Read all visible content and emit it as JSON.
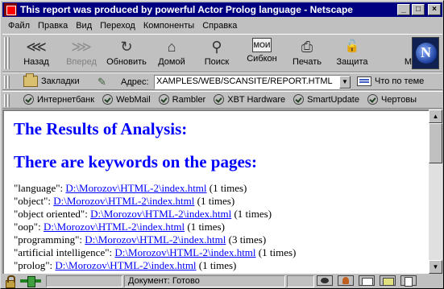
{
  "window": {
    "title": "This report was produced by powerful Actor Prolog language - Netscape",
    "buttons": {
      "minimize": "_",
      "maximize": "□",
      "close": "×"
    }
  },
  "menu": [
    "Файл",
    "Правка",
    "Вид",
    "Переход",
    "Компоненты",
    "Справка"
  ],
  "nav_toolbar": [
    {
      "label": "Назад",
      "icon": "back-arrows-icon",
      "glyph": "⋘",
      "enabled": true
    },
    {
      "label": "Вперед",
      "icon": "forward-arrows-icon",
      "glyph": "⋙",
      "enabled": false
    },
    {
      "label": "Обновить",
      "icon": "reload-icon",
      "glyph": "↻",
      "enabled": true
    },
    {
      "label": "Домой",
      "icon": "home-icon",
      "glyph": "⌂",
      "enabled": true
    },
    {
      "label": "Поиск",
      "icon": "search-icon",
      "glyph": "⚲",
      "enabled": true
    },
    {
      "label": "Сибкон",
      "icon": "sibkon-icon",
      "glyph": "МОИ",
      "enabled": true
    },
    {
      "label": "Печать",
      "icon": "print-icon",
      "glyph": "⎙",
      "enabled": true
    },
    {
      "label": "Защита",
      "icon": "security-lock-icon",
      "glyph": "🔓",
      "enabled": true
    },
    {
      "label": "M",
      "icon": "more-icon",
      "glyph": "",
      "enabled": true
    }
  ],
  "location_bar": {
    "bookmarks_label": "Закладки",
    "address_label": "Адрес:",
    "address_value": "XAMPLES/WEB/SCANSITE/REPORT.HTML",
    "related_label": "Что по теме"
  },
  "personal_toolbar": [
    "Интернетбанк",
    "WebMail",
    "Rambler",
    "XBT Hardware",
    "SmartUpdate",
    "Чертовы"
  ],
  "page": {
    "heading1": "The Results of Analysis:",
    "heading2": "There are keywords on the pages:",
    "keywords": [
      {
        "keyword": "\"language\":",
        "link": "D:\\Morozov\\HTML-2\\index.html",
        "count": "(1 times)"
      },
      {
        "keyword": "\"object\":",
        "link": "D:\\Morozov\\HTML-2\\index.html",
        "count": "(1 times)"
      },
      {
        "keyword": "\"object oriented\":",
        "link": "D:\\Morozov\\HTML-2\\index.html",
        "count": "(1 times)"
      },
      {
        "keyword": "\"oop\":",
        "link": "D:\\Morozov\\HTML-2\\index.html",
        "count": "(1 times)"
      },
      {
        "keyword": "\"programming\":",
        "link": "D:\\Morozov\\HTML-2\\index.html",
        "count": "(3 times)"
      },
      {
        "keyword": "\"artificial intelligence\":",
        "link": "D:\\Morozov\\HTML-2\\index.html",
        "count": "(1 times)"
      },
      {
        "keyword": "\"prolog\":",
        "link": "D:\\Morozov\\HTML-2\\index.html",
        "count": "(1 times)"
      }
    ]
  },
  "status_bar": {
    "text": "Документ: Готово"
  }
}
